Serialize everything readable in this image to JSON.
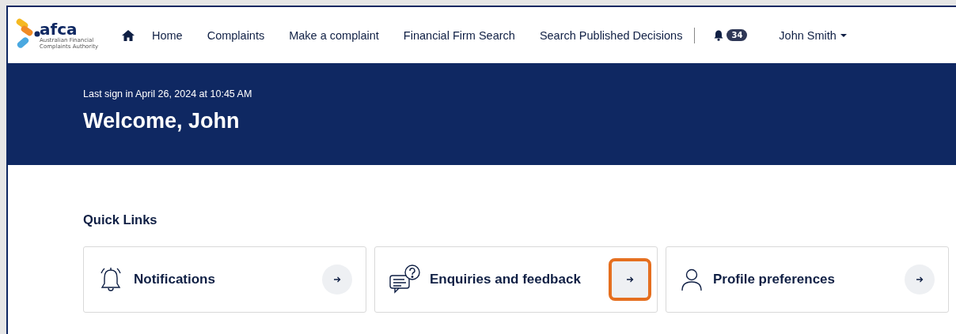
{
  "logo": {
    "wordmark": "afca",
    "tagline": "Australian Financial Complaints Authority"
  },
  "nav": {
    "items": [
      {
        "label": "Home"
      },
      {
        "label": "Complaints"
      },
      {
        "label": "Make a complaint"
      },
      {
        "label": "Financial Firm Search"
      },
      {
        "label": "Search Published Decisions"
      }
    ],
    "notification_count": "34",
    "user": "John Smith"
  },
  "banner": {
    "last_sign_in": "Last sign in April 26, 2024 at 10:45 AM",
    "greeting": "Welcome, John"
  },
  "quick_links": {
    "title": "Quick Links",
    "items": [
      {
        "kind": "bell",
        "label": "Notifications",
        "highlighted": false
      },
      {
        "kind": "chat",
        "label": "Enquiries and feedback",
        "highlighted": true
      },
      {
        "kind": "person",
        "label": "Profile preferences",
        "highlighted": false
      }
    ]
  }
}
